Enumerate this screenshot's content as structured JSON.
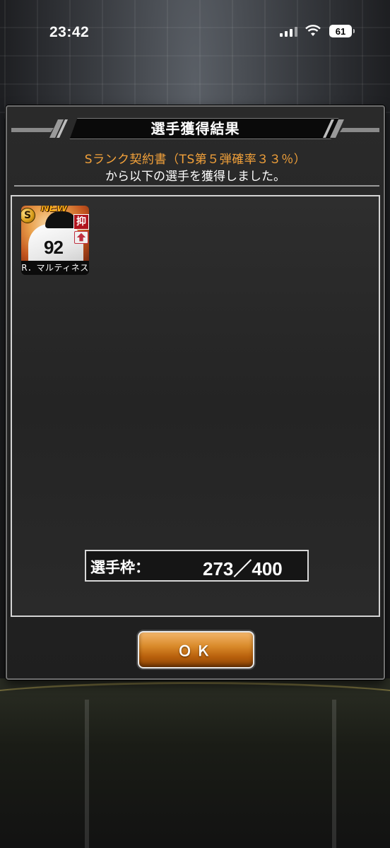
{
  "status_bar": {
    "time": "23:42",
    "battery": "61"
  },
  "dialog": {
    "title": "選手獲得結果",
    "contract_line": "Sランク契約書（TS第５弾確率３３％）",
    "result_line": "から以下の選手を獲得しました。",
    "players": [
      {
        "name": "R．マルティネス",
        "rank": "S",
        "new_label": "NEW",
        "role": "抑",
        "number": "92",
        "icon": "upgrade-arrow-icon"
      }
    ],
    "capacity": {
      "label": "選手枠：",
      "value": "273／400"
    },
    "ok_label": "ＯＫ"
  },
  "colors": {
    "accent_orange": "#f2a13a",
    "button_brown": "#b8600c",
    "role_red": "#b0141e"
  }
}
